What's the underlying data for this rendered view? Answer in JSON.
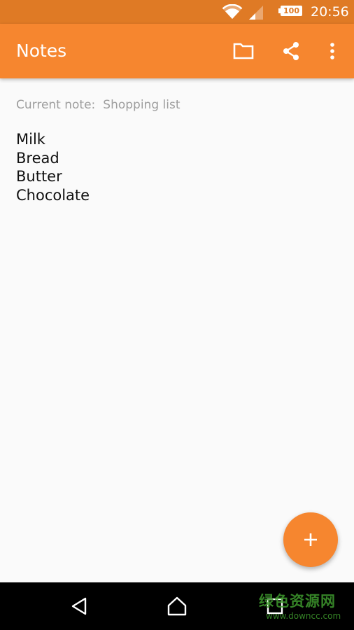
{
  "status_bar": {
    "battery_level": "100",
    "time": "20:56",
    "icons": [
      "wifi-icon",
      "signal-icon",
      "battery-icon"
    ]
  },
  "app_bar": {
    "title": "Notes",
    "actions": [
      "folder-icon",
      "share-icon",
      "overflow-menu-icon"
    ]
  },
  "note": {
    "current_label": "Current note:",
    "current_name": "Shopping list",
    "items": [
      "Milk",
      "Bread",
      "Butter",
      "Chocolate"
    ]
  },
  "fab": {
    "icon": "add-icon"
  },
  "nav_bar": {
    "buttons": [
      "back-icon",
      "home-icon",
      "recents-icon"
    ]
  },
  "watermark": {
    "line1": "绿色资源网",
    "line2": "www.downcc.com"
  },
  "colors": {
    "status_bar": "#df7a25",
    "app_bar": "#f6862f",
    "fab": "#f6862f",
    "background": "#fafafa",
    "nav_bar": "#000000",
    "watermark": "#3f9b2e"
  }
}
